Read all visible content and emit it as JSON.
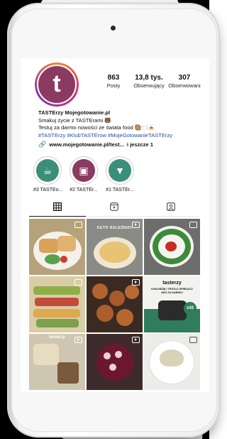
{
  "profile": {
    "stats": [
      {
        "value": "863",
        "label": "Posty"
      },
      {
        "value": "13,8 tys.",
        "label": "Obserwujący"
      },
      {
        "value": "307",
        "label": "Obserwowani"
      }
    ],
    "bio": {
      "name": "TASTErzy Mojegotowanie.pl",
      "line1": "Smakuj życie z TASTErami 🐻",
      "line2": "Testuj za darmo nowości ze świata food 🥘🍽️🍝",
      "hashtags": "#TASTErzy #KlubTASTErow #MojeGotowanieTASTErzy"
    },
    "link": {
      "url": "www.mojegotowanie.pl/test...",
      "more": "i jeszcze 1"
    }
  },
  "highlights": [
    {
      "label": "#3 TASTEo..."
    },
    {
      "label": "#2 TASTEr..."
    },
    {
      "label": "#1 TASTEr..."
    }
  ],
  "tabs": [
    {
      "icon": "grid-icon"
    },
    {
      "icon": "reels-icon"
    },
    {
      "icon": "tagged-icon"
    }
  ],
  "posts": [
    {
      "caption": ""
    },
    {
      "caption": "KETO NALEŚNIKI"
    },
    {
      "caption": ""
    },
    {
      "caption": ""
    },
    {
      "caption": ""
    },
    {
      "caption_top": "tasterzy",
      "caption_mid": "DOKOŃŚIĘ I TESTUJ OPIEKACZ 3W1 ZA DARMO!",
      "badge": "x43"
    },
    {
      "caption": "tasterzy"
    },
    {
      "caption": ""
    },
    {
      "caption": ""
    }
  ],
  "colors": {
    "brand": "#8b3a62",
    "link": "#1e4f9c"
  }
}
